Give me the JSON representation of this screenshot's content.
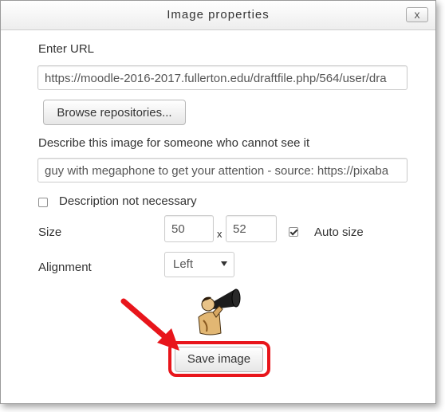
{
  "dialog": {
    "title": "Image properties",
    "close_label": "x"
  },
  "url": {
    "label": "Enter URL",
    "value": "https://moodle-2016-2017.fullerton.edu/draftfile.php/564/user/dra"
  },
  "browse_button": "Browse repositories...",
  "description": {
    "label": "Describe this image for someone who cannot see it",
    "value": "guy with megaphone to get your attention - source: https://pixaba"
  },
  "description_not_necessary": {
    "label": "Description not necessary",
    "checked": false
  },
  "size": {
    "label": "Size",
    "width": "50",
    "separator": "x",
    "height": "52",
    "auto_size_label": "Auto size",
    "auto_size_checked": true
  },
  "alignment": {
    "label": "Alignment",
    "selected": "Left"
  },
  "preview": {
    "icon": "megaphone-man-image"
  },
  "save_button": "Save image",
  "annotation": {
    "highlight_color": "#e8151b"
  }
}
